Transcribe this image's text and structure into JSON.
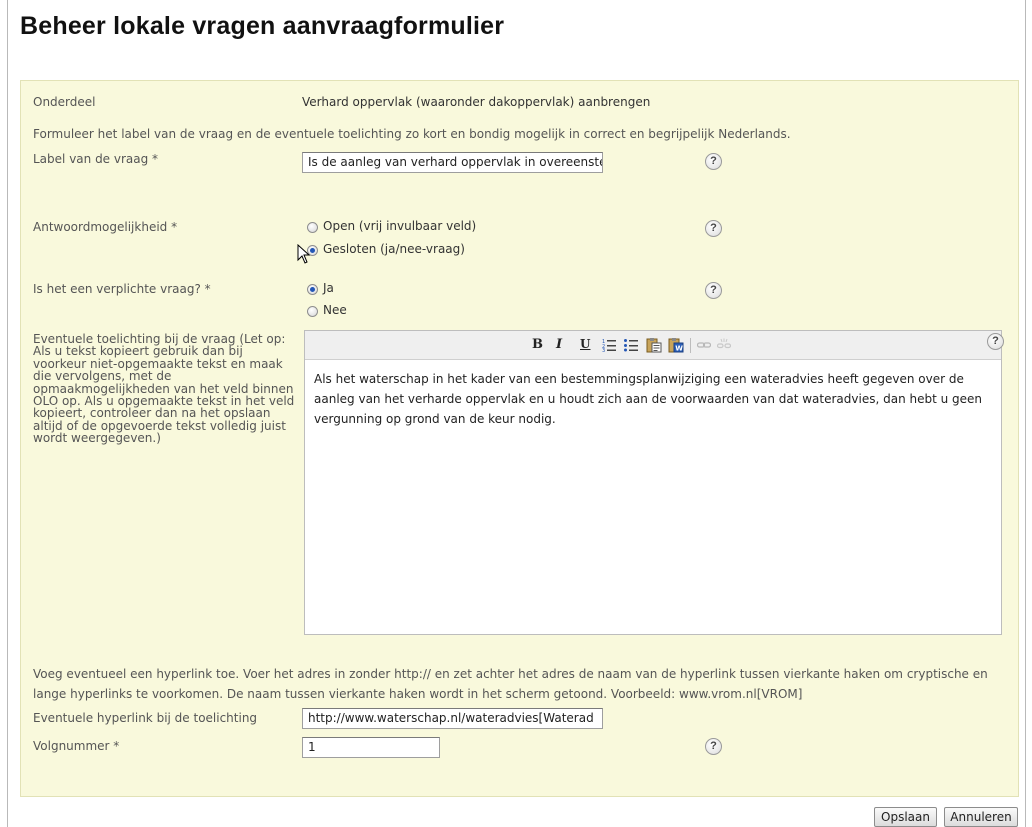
{
  "page": {
    "title": "Beheer lokale vragen aanvraagformulier"
  },
  "onderdeel": {
    "label": "Onderdeel",
    "value": "Verhard oppervlak (waaronder dakoppervlak) aanbrengen"
  },
  "instruction": "Formuleer het label van de vraag en de eventuele toelichting zo kort en bondig mogelijk in correct en begrijpelijk Nederlands.",
  "vraag_label": {
    "label": "Label van de vraag *",
    "value": "Is de aanleg van verhard oppervlak in overeenste",
    "help": "?"
  },
  "antwoord": {
    "label": "Antwoordmogelijkheid *",
    "options": [
      {
        "label": "Open (vrij invulbaar veld)",
        "selected": false
      },
      {
        "label": "Gesloten (ja/nee-vraag)",
        "selected": true
      }
    ],
    "help": "?"
  },
  "verplicht": {
    "label": "Is het een verplichte vraag? *",
    "options": [
      {
        "label": "Ja",
        "selected": true
      },
      {
        "label": "Nee",
        "selected": false
      }
    ],
    "help": "?"
  },
  "toelichting": {
    "label": "Eventuele toelichting bij de vraag (Let op: Als u tekst kopieert gebruik dan bij voorkeur niet-opgemaakte tekst en maak die vervolgens, met de opmaakmogelijkheden van het veld binnen OLO op. Als u opgemaakte tekst in het veld kopieert, controleer dan na het opslaan altijd of de opgevoerde tekst volledig juist wordt weergegeven.)",
    "toolbar": {
      "bold": "B",
      "italic": "I",
      "underline": "U"
    },
    "text": "Als het waterschap in het kader van een bestemmingsplanwijziging een wateradvies heeft gegeven over de aanleg van het verharde oppervlak en u houdt zich aan de voorwaarden van dat wateradvies, dan hebt u geen vergunning op grond van de keur nodig.",
    "help": "?"
  },
  "hyperlink_info": "Voeg eventueel een hyperlink toe. Voer het adres in zonder http:// en zet achter het adres de naam van de hyperlink tussen vierkante haken om cryptische en lange hyperlinks te voorkomen. De naam tussen vierkante haken wordt in het scherm getoond. Voorbeeld: www.vrom.nl[VROM]",
  "hyperlink": {
    "label": "Eventuele hyperlink bij de toelichting",
    "value": "http://www.waterschap.nl/wateradvies[Waterad"
  },
  "volgnummer": {
    "label": "Volgnummer *",
    "value": "1",
    "help": "?"
  },
  "buttons": {
    "save": "Opslaan",
    "cancel": "Annuleren"
  },
  "colors": {
    "panel_bg": "#f9f9dc",
    "radio_checked": "#2457b6"
  }
}
